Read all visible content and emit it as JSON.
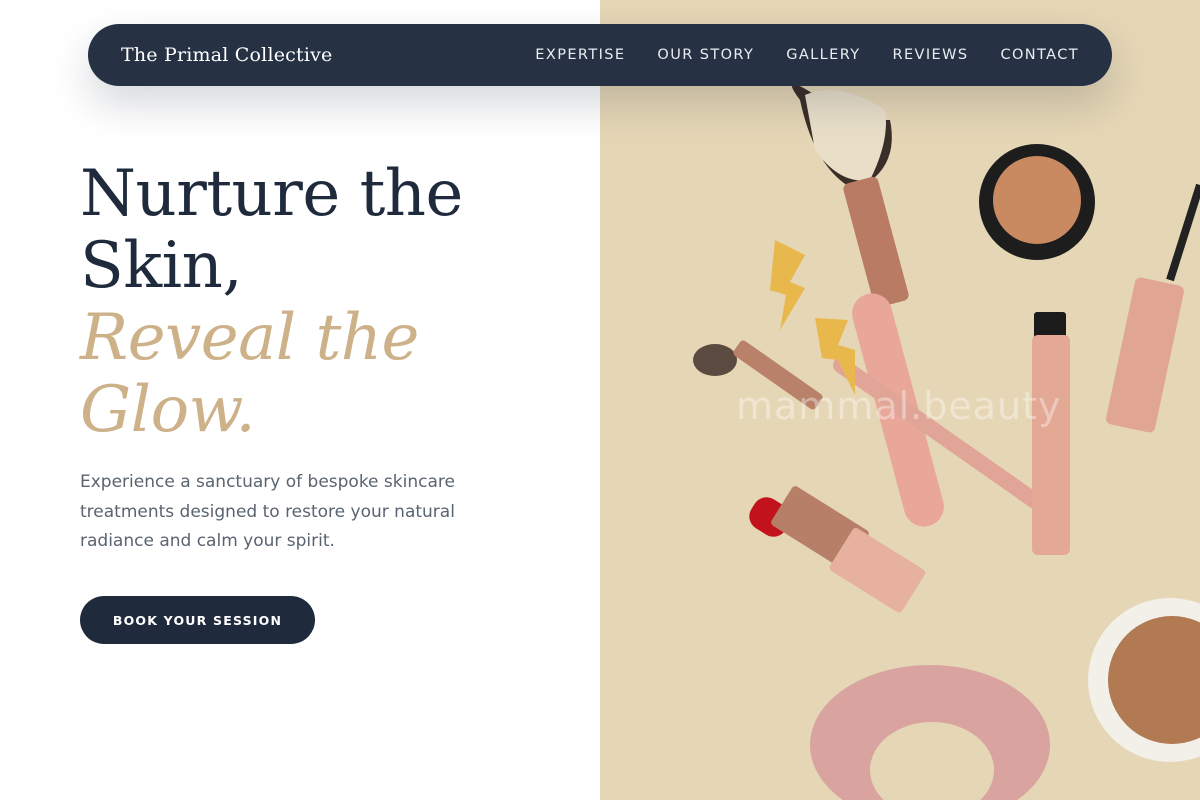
{
  "nav": {
    "brand": "The Primal Collective",
    "links": [
      "EXPERTISE",
      "OUR STORY",
      "GALLERY",
      "REVIEWS",
      "CONTACT"
    ]
  },
  "hero": {
    "title_line1": "Nurture the Skin,",
    "title_line2": "Reveal the Glow.",
    "description": "Experience a sanctuary of bespoke skincare treatments designed to restore your natural radiance and calm your spirit.",
    "cta_label": "BOOK YOUR SESSION"
  },
  "photo": {
    "watermark": "mammal.beauty",
    "subject": "flat-lay makeup: brushes, lipstick, mascara, compact, scrunchie, lightning earrings"
  },
  "colors": {
    "navy": "#263243",
    "gold_accent": "#cdb189",
    "photo_bg": "#e5d6b5",
    "rose_gold": "#e2a593"
  }
}
